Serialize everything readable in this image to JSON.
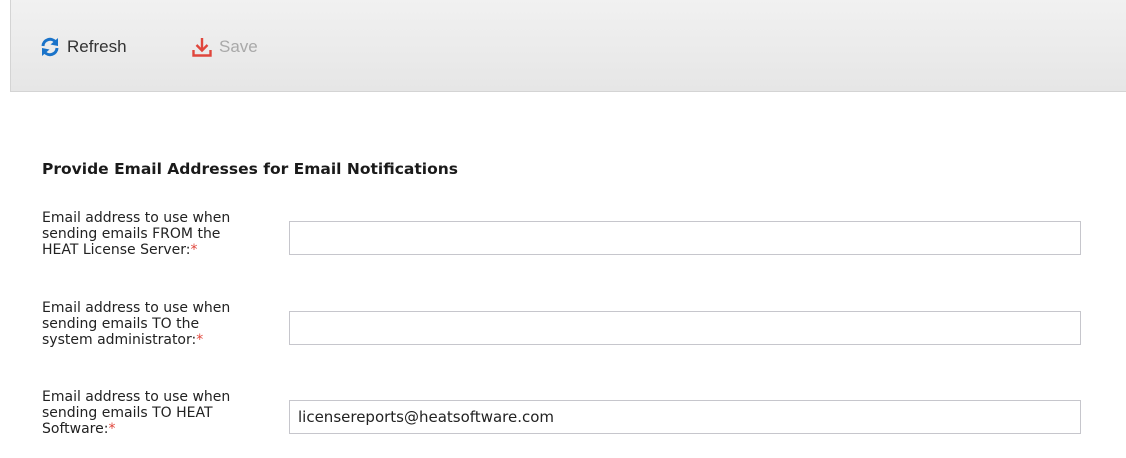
{
  "toolbar": {
    "refresh_label": "Refresh",
    "save_label": "Save",
    "refresh_icon": "refresh-icon",
    "save_icon": "download-icon",
    "colors": {
      "refresh_icon": "#1a73c9",
      "save_icon": "#e0463c",
      "save_disabled_text": "#a9a9a9"
    }
  },
  "form": {
    "title": "Provide Email Addresses for Email Notifications",
    "required_marker": "*",
    "fields": [
      {
        "label_lines": [
          "Email address to use when",
          "sending emails FROM the",
          "HEAT License Server:"
        ],
        "value": ""
      },
      {
        "label_lines": [
          "Email address to use when",
          "sending emails TO the",
          "system administrator:"
        ],
        "value": ""
      },
      {
        "label_lines": [
          "Email address to use when",
          "sending emails TO HEAT",
          "Software:"
        ],
        "value": "licensereports@heatsoftware.com"
      }
    ]
  }
}
